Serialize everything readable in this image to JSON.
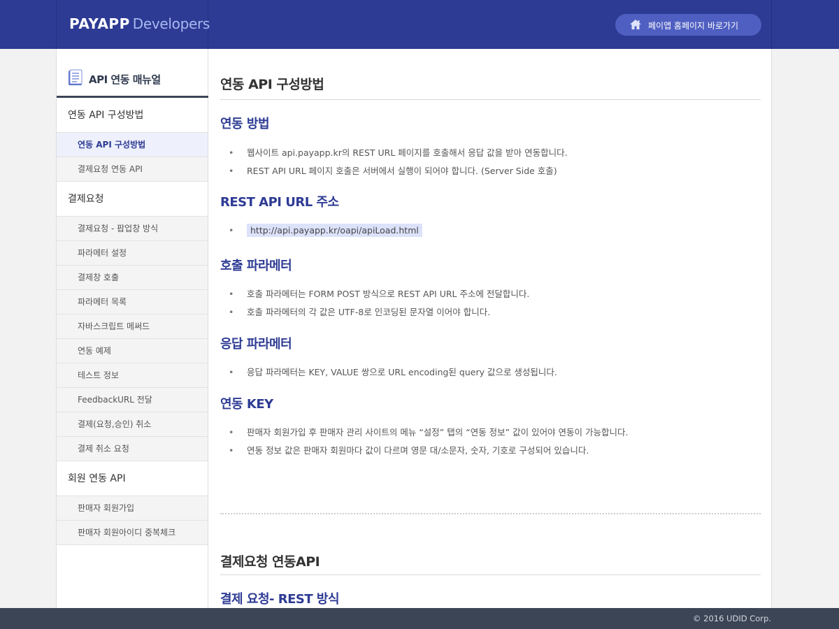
{
  "header": {
    "brand": "PAYAPP",
    "brand_suffix": "Developers",
    "home_button_label": "페이앱 홈페이지 바로가기",
    "home_icon": "home-icon"
  },
  "sidebar": {
    "title": "API 연동 매뉴얼",
    "title_icon": "manual-document-icon",
    "sections": [
      {
        "label": "연동 API 구성방법",
        "items": [
          {
            "label": "연동 API 구성방법",
            "active": true
          },
          {
            "label": "결제요청 연동 API",
            "active": false
          }
        ]
      },
      {
        "label": "결제요청",
        "items": [
          {
            "label": "결제요청 - 팝업창 방식",
            "active": false
          },
          {
            "label": "파라메터 설정",
            "active": false
          },
          {
            "label": "결제창 호출",
            "active": false
          },
          {
            "label": "파라메터 목록",
            "active": false
          },
          {
            "label": "자바스크립트 메써드",
            "active": false
          },
          {
            "label": "연동 예제",
            "active": false
          },
          {
            "label": "테스트 정보",
            "active": false
          },
          {
            "label": "FeedbackURL 전달",
            "active": false
          },
          {
            "label": "결제(요청,승인) 취소",
            "active": false
          },
          {
            "label": "결제 취소 요청",
            "active": false
          }
        ]
      },
      {
        "label": "회원 연동 API",
        "items": [
          {
            "label": "판매자 회원가입",
            "active": false
          },
          {
            "label": "판매자 회원아이디 중복체크",
            "active": false
          }
        ]
      }
    ]
  },
  "content": {
    "title": "연동 API 구성방법",
    "sections": [
      {
        "heading": "연동 방법",
        "bullets": [
          "웹사이트 api.payapp.kr의 REST URL 페이지를 호출해서 응답 값을 받아 연동합니다.",
          "REST API URL 페이지 호출은 서버에서 실행이 되어야 합니다. (Server Side 호출)"
        ]
      },
      {
        "heading": "REST API URL 주소",
        "url": "http://api.payapp.kr/oapi/apiLoad.html"
      },
      {
        "heading": "호출 파라메터",
        "bullets": [
          "호출 파라메터는 FORM POST 방식으로 REST API URL 주소에 전달합니다.",
          "호출 파라메터의 각 값은 UTF-8로 인코딩된 문자열 이어야 합니다."
        ]
      },
      {
        "heading": "응답 파라메터",
        "bullets": [
          "응답 파라메터는 KEY, VALUE 쌍으로 URL encoding된 query 값으로 생성됩니다."
        ]
      },
      {
        "heading": "연동 KEY",
        "bullets": [
          "판매자 회원가입 후 판매자 관리 사이트의 메뉴 “설정” 탭의 “연동 정보” 값이 있어야 연동이 가능합니다.",
          "연동 정보 값은 판매자 회원마다 값이 다르며 영문 대/소문자, 숫자, 기호로 구성되어 있습니다."
        ]
      }
    ],
    "title2": "결제요청 연동API",
    "heading2": "결제 요청- REST 방식"
  },
  "footer": {
    "copyright": "© 2016 UDID Corp."
  },
  "colors": {
    "header_bg": "#2e3b94",
    "home_button_bg": "#4f5fc1",
    "heading_blue": "#2e3b94",
    "footer_bg": "#3b4556",
    "url_highlight": "#dde2fb"
  }
}
